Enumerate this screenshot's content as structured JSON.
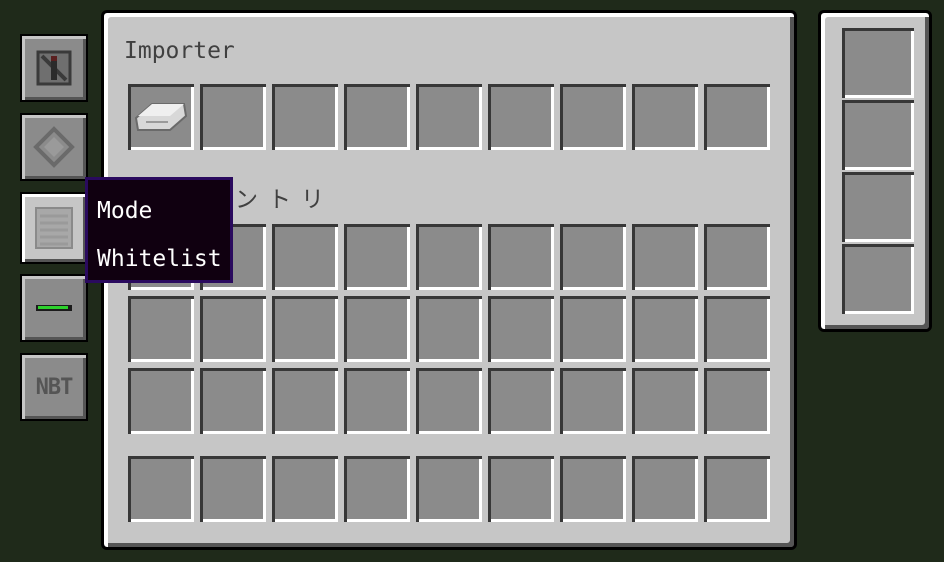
{
  "window_title": "Importer",
  "inventory_label": "インベントリ",
  "tooltip": {
    "title": "Mode",
    "value": "Whitelist"
  },
  "side_buttons": [
    {
      "name": "redstone-mode-button",
      "icon": "redstone-torch-icon"
    },
    {
      "name": "compare-button",
      "icon": "diamond-outline-icon"
    },
    {
      "name": "mode-button",
      "icon": "list-icon"
    },
    {
      "name": "exact-button",
      "icon": "green-bar-icon"
    },
    {
      "name": "nbt-button",
      "label": "NBT"
    }
  ],
  "filter_slots": [
    {
      "item": "iron-ingot"
    },
    {},
    {},
    {},
    {},
    {},
    {},
    {},
    {}
  ],
  "upgrade_slots": 4,
  "colors": {
    "panel": "#c6c6c6",
    "slot": "#8b8b8b",
    "tooltip_bg": "#100010",
    "tooltip_border": "#2a0a5e"
  }
}
